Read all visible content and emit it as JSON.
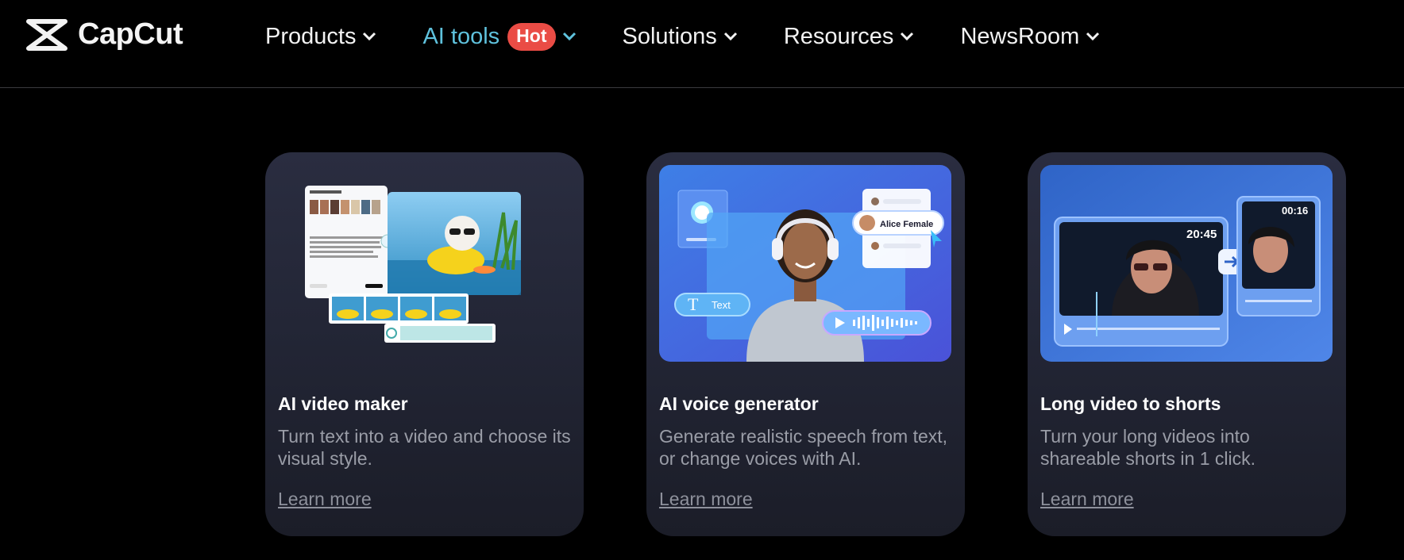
{
  "brand": {
    "name": "CapCut",
    "logo_icon": "capcut-logo-icon"
  },
  "nav": {
    "items": [
      {
        "label": "Products",
        "icon": "chevron-down-icon"
      },
      {
        "label": "AI tools",
        "badge": "Hot",
        "icon": "chevron-down-icon"
      },
      {
        "label": "Solutions",
        "icon": "chevron-down-icon"
      },
      {
        "label": "Resources",
        "icon": "chevron-down-icon"
      },
      {
        "label": "NewsRoom",
        "icon": "chevron-down-icon"
      }
    ]
  },
  "cards": [
    {
      "title": "AI video maker",
      "description": "Turn text into a video and choose its visual style.",
      "link": "Learn more"
    },
    {
      "title": "AI voice generator",
      "description": "Generate realistic speech from text, or change voices with AI.",
      "link": "Learn more",
      "image": {
        "voice_name": "Alice Female",
        "chip_label": "Text"
      }
    },
    {
      "title": "Long video to shorts",
      "description": "Turn your long videos into shareable shorts in 1 click.",
      "link": "Learn more",
      "image": {
        "long_time": "20:45",
        "short_time": "00:16"
      }
    }
  ],
  "colors": {
    "accent": "#5fc2dd",
    "hot_badge": "#ea4c45",
    "background": "#000000"
  }
}
